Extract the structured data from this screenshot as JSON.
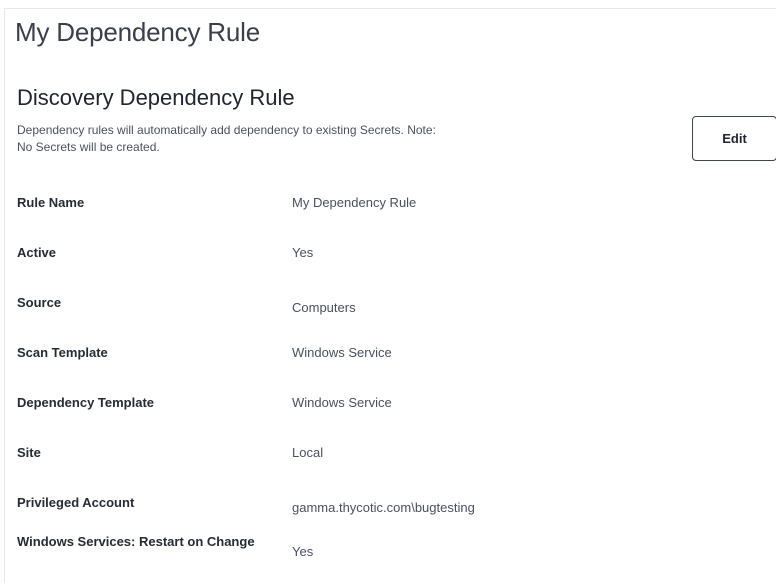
{
  "page": {
    "title": "My Dependency Rule"
  },
  "section": {
    "title": "Discovery Dependency Rule",
    "description_line1": "Dependency rules will automatically add dependency to existing Secrets. Note:",
    "description_line2": "No Secrets will be created.",
    "edit_label": "Edit"
  },
  "details": [
    {
      "label": "Rule Name",
      "value": "My Dependency Rule"
    },
    {
      "label": "Active",
      "value": "Yes"
    },
    {
      "label": "Source",
      "value": "Computers"
    },
    {
      "label": "Scan Template",
      "value": "Windows Service"
    },
    {
      "label": "Dependency Template",
      "value": "Windows Service"
    },
    {
      "label": "Site",
      "value": "Local"
    },
    {
      "label": "Privileged Account",
      "value": "gamma.thycotic.com\\bugtesting"
    },
    {
      "label": "Windows Services: Restart on Change",
      "value": "Yes"
    }
  ],
  "colors": {
    "text_primary": "#1f2430",
    "text_secondary": "#4a5060",
    "button_border": "#3d4452"
  }
}
